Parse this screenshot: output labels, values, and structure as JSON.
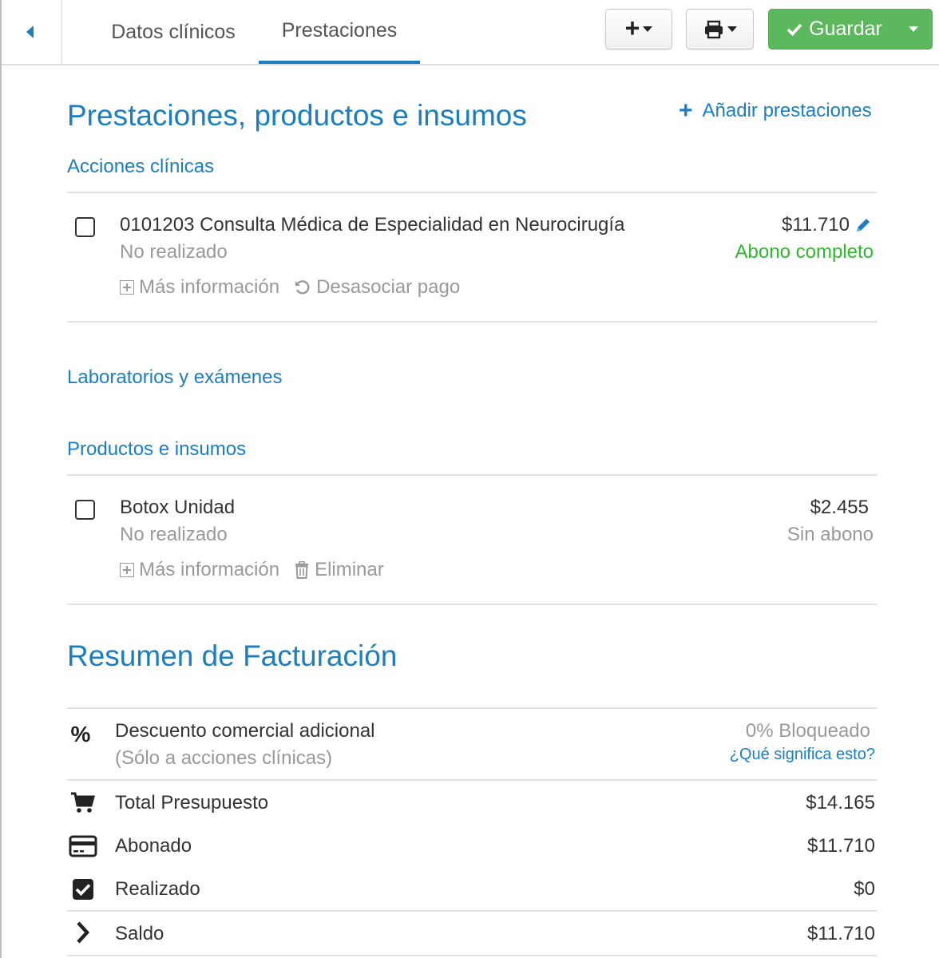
{
  "tabs": [
    {
      "label": "Datos clínicos",
      "active": false
    },
    {
      "label": "Prestaciones",
      "active": true
    }
  ],
  "toolbar": {
    "add_icon": "plus-icon",
    "print_icon": "print-icon",
    "save_label": "Guardar",
    "save_icon": "check-icon",
    "accent_color": "#1a7fc1",
    "save_color": "#5cb85c"
  },
  "main": {
    "title": "Prestaciones, productos e insumos",
    "add_link_label": "Añadir prestaciones",
    "sections": {
      "clinical": {
        "title": "Acciones clínicas",
        "items": [
          {
            "name": "0101203 Consulta Médica de Especialidad en Neurocirugía",
            "status": "No realizado",
            "price": "$11.710",
            "payment_status": "Abono completo",
            "actions": [
              "Más información",
              "Desasociar pago"
            ]
          }
        ]
      },
      "labs": {
        "title": "Laboratorios y exámenes"
      },
      "products": {
        "title": "Productos e insumos",
        "items": [
          {
            "name": "Botox Unidad",
            "status": "No realizado",
            "price": "$2.455",
            "payment_status": "Sin abono",
            "actions": [
              "Más información",
              "Eliminar"
            ]
          }
        ]
      }
    }
  },
  "billing": {
    "title": "Resumen de Facturación",
    "discount": {
      "icon_text": "%",
      "label": "Descuento comercial adicional",
      "sublabel": "(Sólo a acciones clínicas)",
      "value": "0% Bloqueado",
      "help": "¿Qué significa esto?"
    },
    "rows": [
      {
        "icon": "cart-icon",
        "label": "Total Presupuesto",
        "value": "$14.165"
      },
      {
        "icon": "credit-card-icon",
        "label": "Abonado",
        "value": "$11.710"
      },
      {
        "icon": "checkbox-checked-icon",
        "label": "Realizado",
        "value": "$0"
      },
      {
        "icon": "chevron-right-icon",
        "label": "Saldo",
        "value": "$11.710"
      }
    ]
  }
}
